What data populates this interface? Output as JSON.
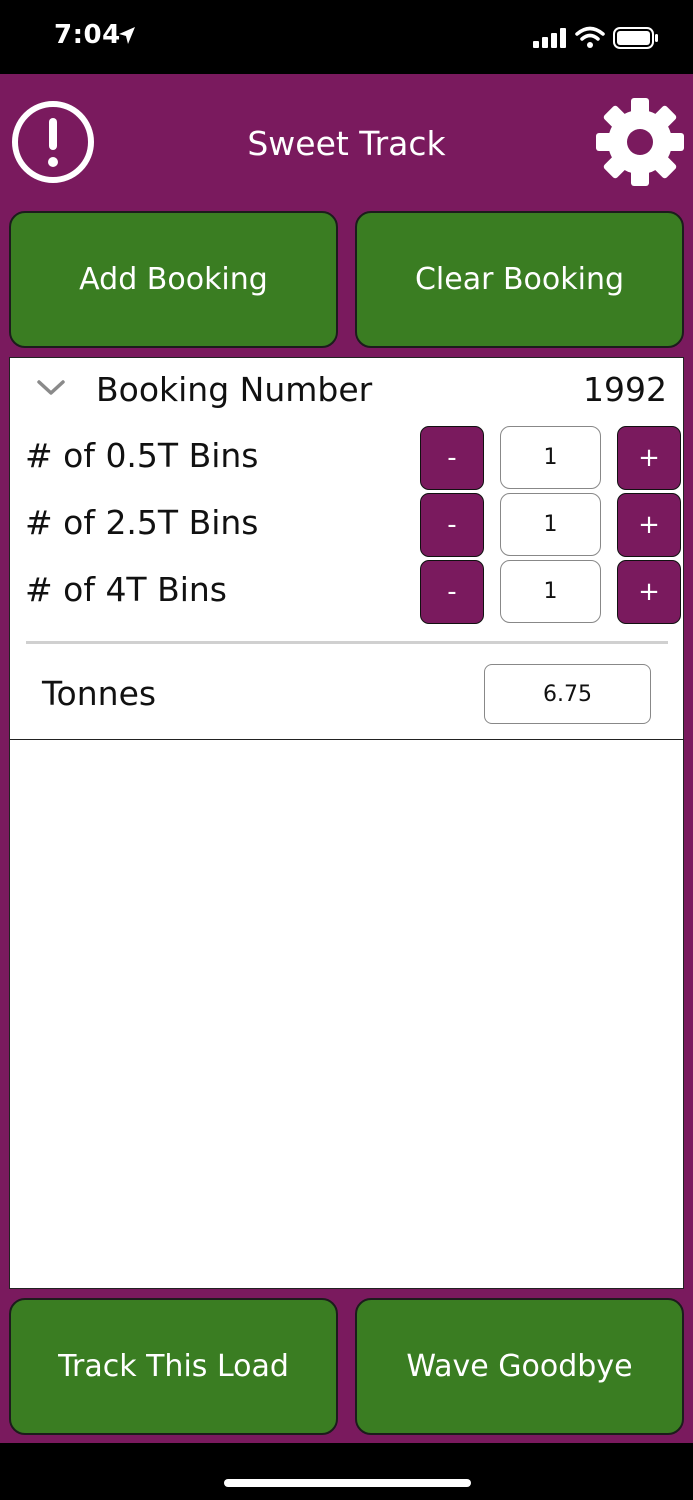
{
  "status_bar": {
    "time": "7:04"
  },
  "header": {
    "title": "Sweet Track"
  },
  "top_buttons": {
    "add_label": "Add Booking",
    "clear_label": "Clear Booking"
  },
  "booking": {
    "label": "Booking Number",
    "number": "1992"
  },
  "bins": [
    {
      "label": "# of 0.5T Bins",
      "minus": "-",
      "qty": "1",
      "plus": "+"
    },
    {
      "label": "# of 2.5T Bins",
      "minus": "-",
      "qty": "1",
      "plus": "+"
    },
    {
      "label": "# of 4T Bins",
      "minus": "-",
      "qty": "1",
      "plus": "+"
    }
  ],
  "tonnes": {
    "label": "Tonnes",
    "value": "6.75"
  },
  "bottom_buttons": {
    "track_label": "Track This Load",
    "wave_label": "Wave Goodbye"
  },
  "colors": {
    "brand": "#7a1a5e",
    "button_green": "#3a7d22"
  },
  "icons": [
    "location-arrow-icon",
    "signal-icon",
    "wifi-icon",
    "battery-icon",
    "alert-icon",
    "gear-icon",
    "chevron-down-icon"
  ]
}
